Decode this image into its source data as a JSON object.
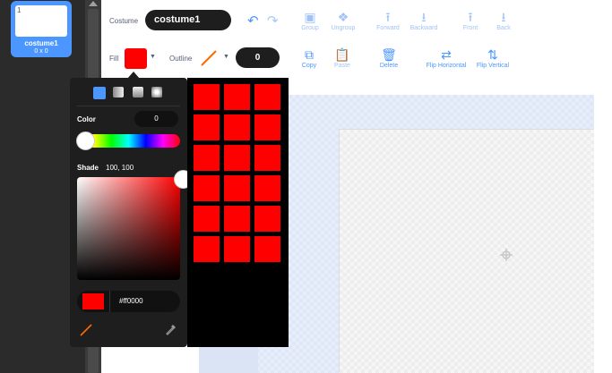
{
  "costume_list": {
    "selected": {
      "number": "1",
      "name": "costume1",
      "size": "0 x 0"
    }
  },
  "toolbar": {
    "costume_label": "Costume",
    "costume_name": "costume1",
    "group": "Group",
    "ungroup": "Ungroup",
    "forward": "Forward",
    "backward": "Backward",
    "front": "Front",
    "back": "Back",
    "fill_label": "Fill",
    "outline_label": "Outline",
    "outline_width": "0",
    "copy": "Copy",
    "paste": "Paste",
    "delete": "Delete",
    "flip_horizontal": "Flip Horizontal",
    "flip_vertical": "Flip Vertical"
  },
  "colors": {
    "fill": "#ff0000",
    "accent": "#4c97ff",
    "outline": "#ff6a00"
  },
  "color_popup": {
    "color_label": "Color",
    "color_value": "0",
    "shade_label": "Shade",
    "shade_value": "100, 100",
    "hex": "#ff0000",
    "fill_modes": [
      "solid",
      "gradient-horizontal",
      "gradient-vertical",
      "gradient-radial"
    ],
    "swatches": [
      "#ff0000",
      "#ff0000",
      "#ff0000",
      "#ff0000",
      "#ff0000",
      "#ff0000",
      "#ff0000",
      "#ff0000",
      "#ff0000",
      "#ff0000",
      "#ff0000",
      "#ff0000",
      "#ff0000",
      "#ff0000",
      "#ff0000",
      "#ff0000",
      "#ff0000",
      "#ff0000"
    ]
  }
}
